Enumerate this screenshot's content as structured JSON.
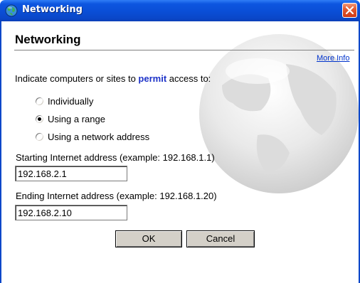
{
  "window": {
    "title": "Networking",
    "close_icon": "close-x-icon",
    "app_icon": "globe-icon"
  },
  "dialog": {
    "heading": "Networking",
    "more_info": "More Info",
    "prompt_before": "Indicate computers or sites to ",
    "prompt_keyword": "permit",
    "prompt_after": " access to:"
  },
  "options": [
    {
      "label": "Individually",
      "selected": false
    },
    {
      "label": "Using a range",
      "selected": true
    },
    {
      "label": "Using a network address",
      "selected": false
    }
  ],
  "start": {
    "label": "Starting Internet address (example: 192.168.1.1)",
    "value": "192.168.2.1"
  },
  "end": {
    "label": "Ending Internet address (example: 192.168.1.20)",
    "value": "192.168.2.10"
  },
  "buttons": {
    "ok": "OK",
    "cancel": "Cancel"
  },
  "colors": {
    "titlebar": "#0a4ed6",
    "keyword": "#1d32c8",
    "link": "#0033cc"
  }
}
